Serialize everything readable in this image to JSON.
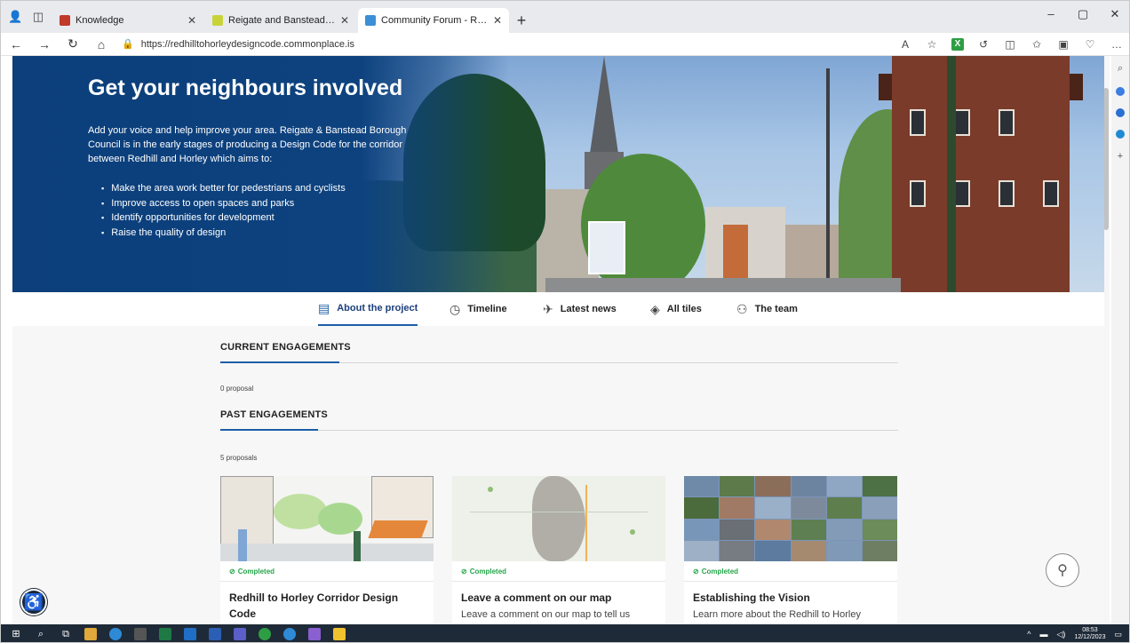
{
  "browser": {
    "tabs": [
      {
        "title": "Knowledge",
        "fav_color": "#c0392b",
        "active": false
      },
      {
        "title": "Reigate and Banstead Homepage",
        "fav_color": "#c8d33a",
        "active": false
      },
      {
        "title": "Community Forum - Redhill To H",
        "fav_color": "#3b8fd6",
        "active": true
      }
    ],
    "url": "https://redhilltohorleydesigncode.commonplace.is",
    "window_controls": [
      "–",
      "▢",
      "✕"
    ]
  },
  "hero": {
    "title": "Get your neighbours involved",
    "description": "Add your voice and help improve your area. Reigate & Banstead Borough Council is in the early stages of producing a Design Code for the corridor between Redhill and Horley which aims to:",
    "aims": [
      "Make the area work better for pedestrians and cyclists",
      "Improve access to open spaces and parks",
      "Identify opportunities for development",
      "Raise the quality of design"
    ]
  },
  "nav": {
    "items": [
      {
        "label": "About the project",
        "icon": "document-icon",
        "glyph": "▤",
        "active": true
      },
      {
        "label": "Timeline",
        "icon": "clock-icon",
        "glyph": "◷",
        "active": false
      },
      {
        "label": "Latest news",
        "icon": "paper-plane-icon",
        "glyph": "✈",
        "active": false
      },
      {
        "label": "All tiles",
        "icon": "layers-icon",
        "glyph": "◈",
        "active": false
      },
      {
        "label": "The team",
        "icon": "people-icon",
        "glyph": "⚇",
        "active": false
      }
    ]
  },
  "current": {
    "heading": "CURRENT ENGAGEMENTS",
    "count": "0 proposal"
  },
  "past": {
    "heading": "PAST ENGAGEMENTS",
    "count": "5 proposals",
    "cards": [
      {
        "status": "Completed",
        "title": "Redhill to Horley Corridor Design Code",
        "desc": ""
      },
      {
        "status": "Completed",
        "title": "Leave a comment on our map",
        "desc": "Leave a comment on our map to tell us"
      },
      {
        "status": "Completed",
        "title": "Establishing the Vision",
        "desc": "Learn more about the Redhill to Horley"
      }
    ]
  },
  "taskbar": {
    "time": "08:53",
    "date": "12/12/2023"
  },
  "colors": {
    "brand_blue": "#0d427f",
    "accent": "#1c5ea8",
    "completed_green": "#26a54a"
  }
}
